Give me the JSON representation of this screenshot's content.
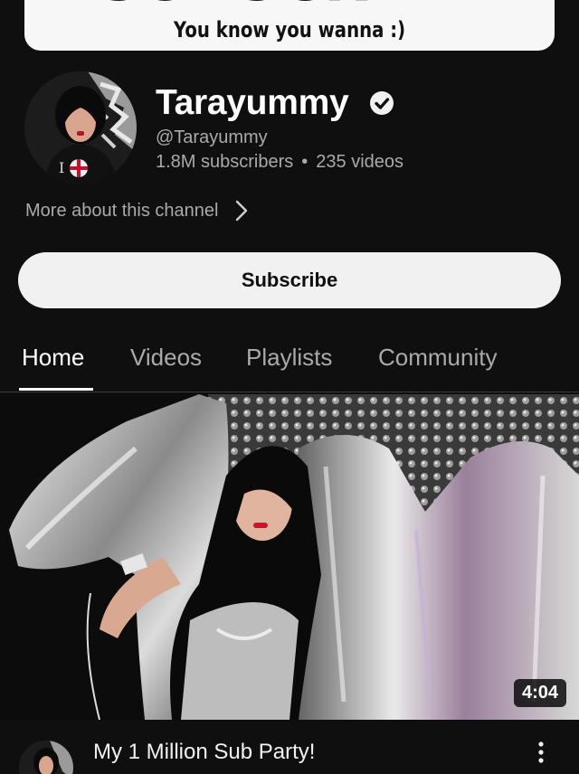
{
  "banner": {
    "big_text": "SUBSCRIBE",
    "tagline": "You know you wanna :)"
  },
  "channel": {
    "name": "Tarayummy",
    "handle": "@Tarayummy",
    "subscribers": "1.8M subscribers",
    "separator": "•",
    "videos": "235 videos",
    "more_about": "More about this channel",
    "verified_icon": "verified-check-icon"
  },
  "subscribe": {
    "label": "Subscribe"
  },
  "tabs": [
    {
      "label": "Home",
      "active": true
    },
    {
      "label": "Videos",
      "active": false
    },
    {
      "label": "Playlists",
      "active": false
    },
    {
      "label": "Community",
      "active": false
    }
  ],
  "featured_video": {
    "duration": "4:04",
    "title": "My 1 Million Sub Party!",
    "menu_icon": "more-vertical-icon"
  },
  "colors": {
    "background": "#0f0f0f",
    "primary_text": "#f1f1f1",
    "secondary_text": "#aaaaaa",
    "button_bg": "#f1f1f1"
  }
}
